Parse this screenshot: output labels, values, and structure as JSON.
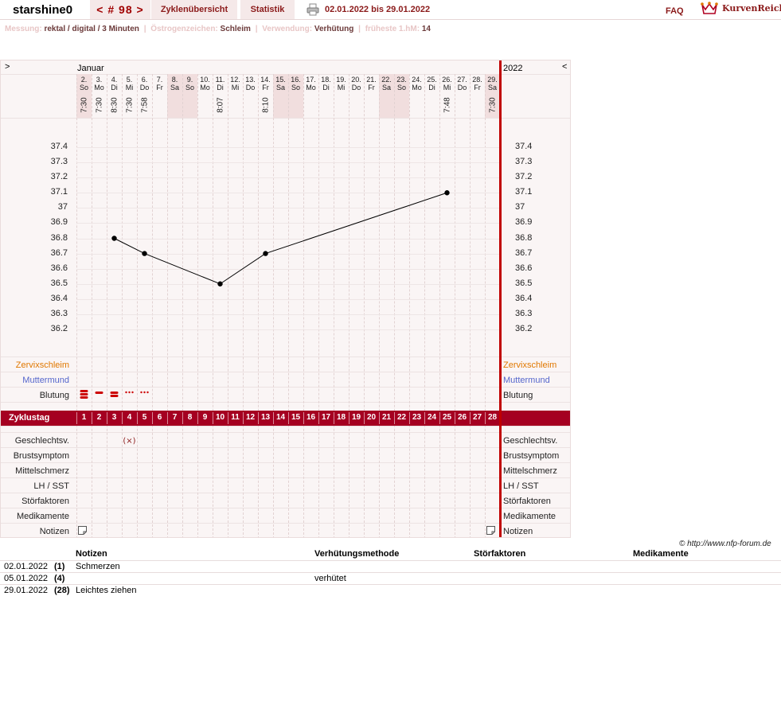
{
  "topbar": {
    "username": "starshine0",
    "cycle_tab": "< # 98 >",
    "overview_tab": "Zyklenübersicht",
    "stats_tab": "Statistik",
    "daterange": "02.01.2022 bis 29.01.2022",
    "faq": "FAQ",
    "brand": "KurvenReich"
  },
  "info": {
    "messung_label": "Messung:",
    "messung_value": "rektal / digital / 3 Minuten",
    "oestrogen_label": "Östrogenzeichen:",
    "oestrogen_value": "Schleim",
    "verwendung_label": "Verwendung:",
    "verwendung_value": "Verhütung",
    "hm_label": "früheste 1.hM:",
    "hm_value": "14"
  },
  "chart_header": {
    "nav_left": ">",
    "nav_right": "<",
    "month": "Januar",
    "year": "2022"
  },
  "days": [
    {
      "date": "2.",
      "dow": "So",
      "time": "7:30",
      "weekend": true
    },
    {
      "date": "3.",
      "dow": "Mo",
      "time": "7:30",
      "weekend": false
    },
    {
      "date": "4.",
      "dow": "Di",
      "time": "8:30",
      "weekend": false
    },
    {
      "date": "5.",
      "dow": "Mi",
      "time": "7:30",
      "weekend": false
    },
    {
      "date": "6.",
      "dow": "Do",
      "time": "7:58",
      "weekend": false
    },
    {
      "date": "7.",
      "dow": "Fr",
      "time": "",
      "weekend": false
    },
    {
      "date": "8.",
      "dow": "Sa",
      "time": "",
      "weekend": true
    },
    {
      "date": "9.",
      "dow": "So",
      "time": "",
      "weekend": true
    },
    {
      "date": "10.",
      "dow": "Mo",
      "time": "",
      "weekend": false
    },
    {
      "date": "11.",
      "dow": "Di",
      "time": "8:07",
      "weekend": false
    },
    {
      "date": "12.",
      "dow": "Mi",
      "time": "",
      "weekend": false
    },
    {
      "date": "13.",
      "dow": "Do",
      "time": "",
      "weekend": false
    },
    {
      "date": "14.",
      "dow": "Fr",
      "time": "8:10",
      "weekend": false
    },
    {
      "date": "15.",
      "dow": "Sa",
      "time": "",
      "weekend": true
    },
    {
      "date": "16.",
      "dow": "So",
      "time": "",
      "weekend": true
    },
    {
      "date": "17.",
      "dow": "Mo",
      "time": "",
      "weekend": false
    },
    {
      "date": "18.",
      "dow": "Di",
      "time": "",
      "weekend": false
    },
    {
      "date": "19.",
      "dow": "Mi",
      "time": "",
      "weekend": false
    },
    {
      "date": "20.",
      "dow": "Do",
      "time": "",
      "weekend": false
    },
    {
      "date": "21.",
      "dow": "Fr",
      "time": "",
      "weekend": false
    },
    {
      "date": "22.",
      "dow": "Sa",
      "time": "",
      "weekend": true
    },
    {
      "date": "23.",
      "dow": "So",
      "time": "",
      "weekend": true
    },
    {
      "date": "24.",
      "dow": "Mo",
      "time": "",
      "weekend": false
    },
    {
      "date": "25.",
      "dow": "Di",
      "time": "",
      "weekend": false
    },
    {
      "date": "26.",
      "dow": "Mi",
      "time": "7:48",
      "weekend": false
    },
    {
      "date": "27.",
      "dow": "Do",
      "time": "",
      "weekend": false
    },
    {
      "date": "28.",
      "dow": "Fr",
      "time": "",
      "weekend": false
    },
    {
      "date": "29.",
      "dow": "Sa",
      "time": "7:30",
      "weekend": true
    }
  ],
  "chart_data": {
    "type": "line",
    "xlabel": "Zyklustag",
    "ylabel": "",
    "ylim": [
      36.2,
      37.4
    ],
    "y_ticks": [
      "37.4",
      "37.3",
      "37.2",
      "37.1",
      "37",
      "36.9",
      "36.8",
      "36.7",
      "36.6",
      "36.5",
      "36.4",
      "36.3",
      "36.2"
    ],
    "series": [
      {
        "points": [
          {
            "day": 3,
            "temp": 36.8
          },
          {
            "day": 5,
            "temp": 36.7
          },
          {
            "day": 10,
            "temp": 36.5
          },
          {
            "day": 13,
            "temp": 36.7
          },
          {
            "day": 25,
            "temp": 37.1
          }
        ]
      }
    ],
    "cycle_days": [
      "1",
      "2",
      "3",
      "4",
      "5",
      "6",
      "7",
      "8",
      "9",
      "10",
      "11",
      "12",
      "13",
      "14",
      "15",
      "16",
      "17",
      "18",
      "19",
      "20",
      "21",
      "22",
      "23",
      "24",
      "25",
      "26",
      "27",
      "28"
    ]
  },
  "rows": {
    "zervix": "Zervixschleim",
    "muttermund": "Muttermund",
    "blutung": "Blutung",
    "zyklustag": "Zyklustag",
    "geschlechtsv": "Geschlechtsv.",
    "brustsymptom": "Brustsymptom",
    "mittelschmerz": "Mittelschmerz",
    "lh_sst": "LH / SST",
    "stoerfaktoren": "Störfaktoren",
    "medikamente": "Medikamente",
    "notizen": "Notizen"
  },
  "bleeding": [
    {
      "day": 1,
      "level": "heavy"
    },
    {
      "day": 2,
      "level": "medium"
    },
    {
      "day": 3,
      "level": "heavy-medium"
    },
    {
      "day": 4,
      "level": "spotting"
    },
    {
      "day": 5,
      "level": "spotting"
    }
  ],
  "intercourse_marker": {
    "day": 4,
    "symbol": "(×)"
  },
  "colors": {
    "accent": "#a50021",
    "zervix": "#e07800",
    "muttermund": "#5566cc",
    "bleeding": "#cc0000"
  },
  "copyright": "© http://www.nfp-forum.de",
  "notes_table": {
    "headers": [
      "Notizen",
      "Verhütungsmethode",
      "Störfaktoren",
      "Medikamente"
    ],
    "rows": [
      {
        "date": "02.01.2022",
        "day": "(1)",
        "note": "Schmerzen",
        "method": "",
        "stoer": "",
        "med": ""
      },
      {
        "date": "05.01.2022",
        "day": "(4)",
        "note": "",
        "method": "verhütet",
        "stoer": "",
        "med": ""
      },
      {
        "date": "29.01.2022",
        "day": "(28)",
        "note": "Leichtes ziehen",
        "method": "",
        "stoer": "",
        "med": ""
      }
    ]
  }
}
